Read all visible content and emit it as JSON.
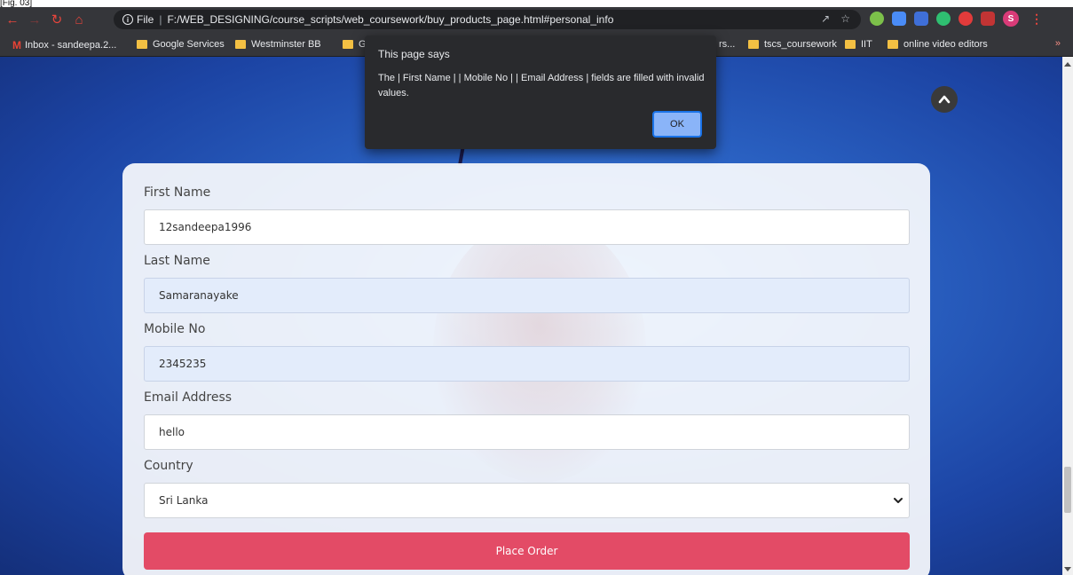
{
  "caption": "[Fig. 03]",
  "browser": {
    "url_scheme_label": "File",
    "url": "F:/WEB_DESIGNING/course_scripts/web_coursework/buy_products_page.html#personal_info",
    "avatar_letter": "S"
  },
  "bookmarks": [
    {
      "label": "Inbox - sandeepa.2...",
      "icon": "gmail-icon"
    },
    {
      "label": "Google Services",
      "icon": "folder-icon"
    },
    {
      "label": "Westminster BB",
      "icon": "folder-icon"
    },
    {
      "label": "Gith",
      "icon": "folder-icon"
    },
    {
      "label": "rs...",
      "icon": "folder-icon"
    },
    {
      "label": "tscs_coursework",
      "icon": "folder-icon"
    },
    {
      "label": "IIT",
      "icon": "folder-icon"
    },
    {
      "label": "online video editors",
      "icon": "folder-icon"
    }
  ],
  "dialog": {
    "title": "This page says",
    "message": "The | First Name |  | Mobile No |  | Email Address |  fields are filled with invalid values.",
    "ok_label": "OK"
  },
  "form": {
    "first_name": {
      "label": "First Name",
      "value": "12sandeepa1996"
    },
    "last_name": {
      "label": "Last Name",
      "value": "Samaranayake"
    },
    "mobile": {
      "label": "Mobile No",
      "value": "2345235"
    },
    "email": {
      "label": "Email Address",
      "value": "hello"
    },
    "country": {
      "label": "Country",
      "value": "Sri Lanka"
    },
    "submit_label": "Place Order"
  },
  "colors": {
    "accent_button": "#e34b66",
    "page_background": "#2b63c4",
    "dialog_background": "#292a2d"
  }
}
